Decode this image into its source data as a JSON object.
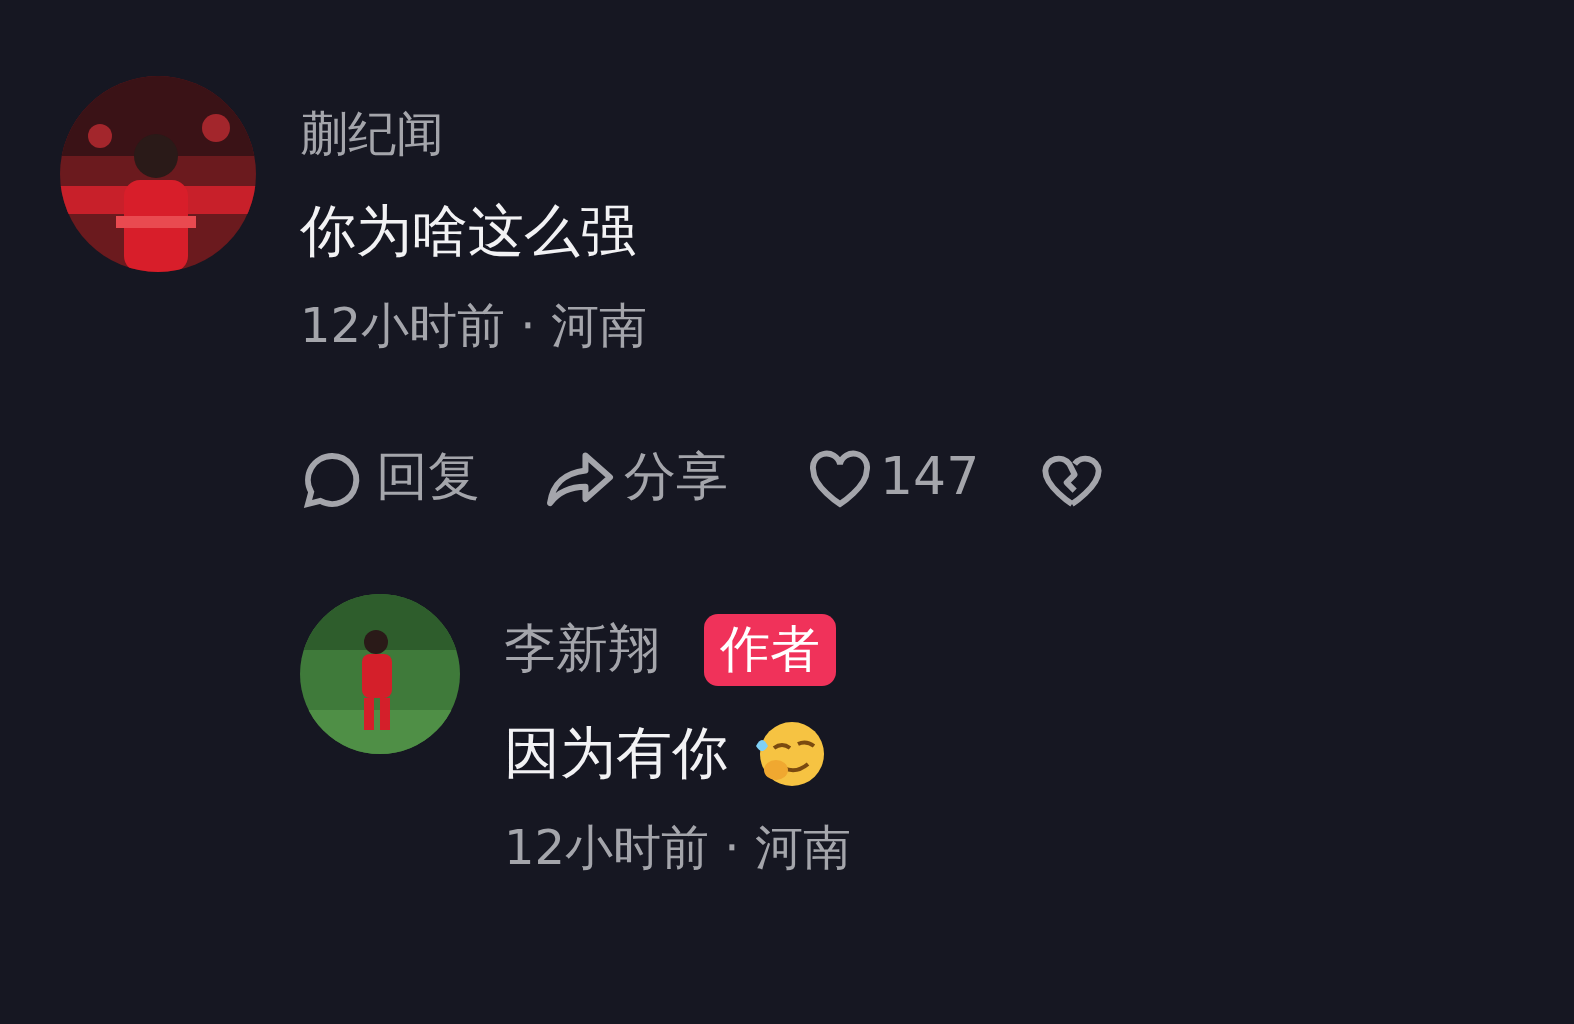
{
  "comment": {
    "author": "蒯纪闻",
    "text": "你为啥这么强",
    "meta": "12小时前 · 河南",
    "actions": {
      "reply": "回复",
      "share": "分享",
      "likes": "147"
    }
  },
  "reply": {
    "author": "李新翔",
    "badge": "作者",
    "text": "因为有你",
    "meta": "12小时前 · 河南"
  }
}
